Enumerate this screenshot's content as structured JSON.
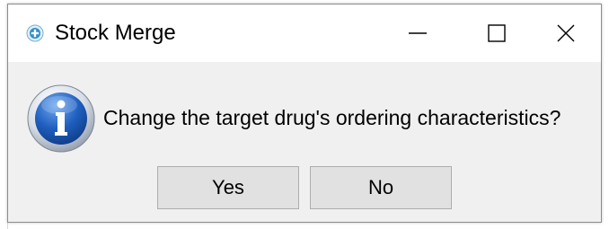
{
  "window": {
    "title": "Stock Merge",
    "app_icon": "stock-merge-app-icon",
    "controls": {
      "minimize_icon": "minimize-icon",
      "maximize_icon": "maximize-icon",
      "close_icon": "close-icon"
    }
  },
  "dialog": {
    "icon": "info-icon",
    "message": "Change the target drug's ordering characteristics?",
    "buttons": {
      "yes_label": "Yes",
      "no_label": "No"
    }
  },
  "colors": {
    "titlebar_bg": "#ffffff",
    "body_bg": "#f0f0f0",
    "button_bg": "#e1e1e1",
    "button_border": "#adadad",
    "info_blue": "#1f5fbf"
  }
}
